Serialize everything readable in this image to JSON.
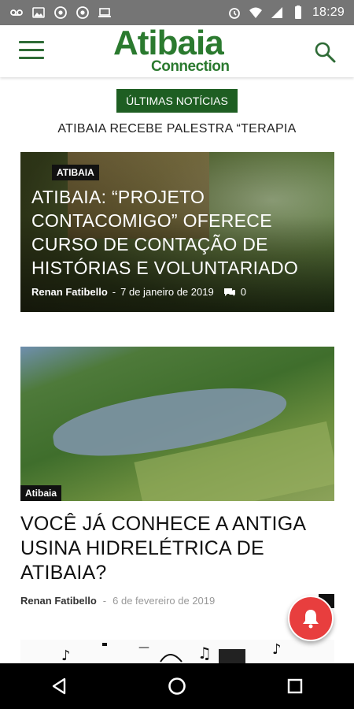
{
  "status_bar": {
    "time": "18:29",
    "left_icons": [
      "voicemail-icon",
      "image-icon",
      "chrome-icon",
      "chrome-icon",
      "laptop-icon"
    ],
    "right_icons": [
      "alarm-icon",
      "wifi-icon",
      "signal-icon",
      "battery-icon"
    ]
  },
  "app_bar": {
    "logo_main": "Atibaia",
    "logo_sub": "Connection",
    "menu_icon": "menu-icon",
    "search_icon": "search-icon"
  },
  "ticker": {
    "badge": "ÚLTIMAS NOTÍCIAS",
    "headline": "ATIBAIA RECEBE PALESTRA “TERAPIA"
  },
  "articles": [
    {
      "category": "ATIBAIA",
      "title": "ATIBAIA: “PROJETO CONTACOMIGO” OFERECE CURSO DE CONTAÇÃO DE HISTÓRIAS E VOLUNTARIADO",
      "author": "Renan Fatibello",
      "separator": "-",
      "date": "7 de janeiro de 2019",
      "comments": "0"
    },
    {
      "category": "Atibaia",
      "title": "VOCÊ JÁ CONHECE A ANTIGA USINA HIDRELÉTRICA DE ATIBAIA?",
      "author": "Renan Fatibello",
      "separator": "-",
      "date": "6 de fevereiro de 2019"
    }
  ],
  "fab": {
    "icon": "bell-icon"
  },
  "nav_bar": {
    "icons": [
      "back-icon",
      "home-icon",
      "recents-icon"
    ]
  },
  "colors": {
    "brand_green": "#2b7a2f",
    "badge_green": "#1e5e22",
    "fab_red": "#e83e3e"
  }
}
